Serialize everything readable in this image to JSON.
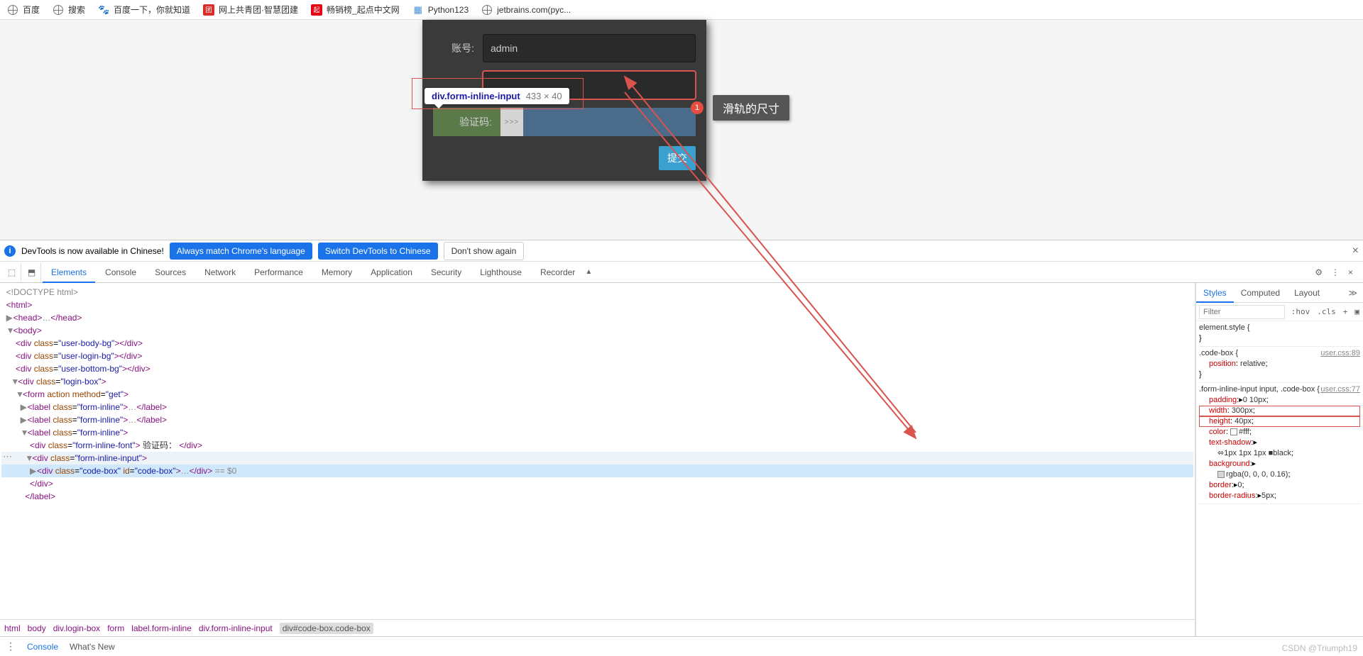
{
  "bookmarks": [
    {
      "icon": "globe",
      "label": "百度"
    },
    {
      "icon": "globe",
      "label": "搜索"
    },
    {
      "icon": "baidu",
      "label": "百度一下，你就知道"
    },
    {
      "icon": "red",
      "label": "网上共青团·智慧团建"
    },
    {
      "icon": "qidian",
      "label": "畅销榜_起点中文网"
    },
    {
      "icon": "python",
      "label": "Python123"
    },
    {
      "icon": "globe",
      "label": "jetbrains.com(pyc..."
    }
  ],
  "login": {
    "account_label": "账号:",
    "account_value": "admin",
    "captcha_label": "验证码:",
    "slider_hint": ">>>",
    "submit": "提交"
  },
  "inspect_tip": {
    "selector": "div.form-inline-input",
    "dims": "433 × 40"
  },
  "annotation": {
    "badge": "1",
    "text": "滑轨的尺寸"
  },
  "devtools": {
    "banner": {
      "msg": "DevTools is now available in Chinese!",
      "btn1": "Always match Chrome's language",
      "btn2": "Switch DevTools to Chinese",
      "btn3": "Don't show again"
    },
    "tabs": [
      "Elements",
      "Console",
      "Sources",
      "Network",
      "Performance",
      "Memory",
      "Application",
      "Security",
      "Lighthouse",
      "Recorder"
    ],
    "active_tab": "Elements",
    "dom": {
      "l0": "<!DOCTYPE html>",
      "code_text": "验证码：",
      "eq": "== $0"
    },
    "breadcrumbs": [
      "html",
      "body",
      "div.login-box",
      "form",
      "label.form-inline",
      "div.form-inline-input",
      "div#code-box.code-box"
    ],
    "styles": {
      "tabs": [
        "Styles",
        "Computed",
        "Layout"
      ],
      "filter_ph": "Filter",
      "hov": ":hov",
      "cls": ".cls",
      "r1": {
        "sel": "element.style {"
      },
      "r2": {
        "sel": ".code-box {",
        "src": "user.css:89",
        "p1n": "position",
        "p1v": "relative"
      },
      "r3": {
        "sel": ".form-inline-input input, .code-box {",
        "src": "user.css:77",
        "p1n": "padding",
        "p1v": "0 10px",
        "p2n": "width",
        "p2v": "300px",
        "p3n": "height",
        "p3v": "40px",
        "p4n": "color",
        "p4v": "#fff",
        "p5n": "text-shadow",
        "p5v": "1px 1px 1px ■black",
        "p6n": "background",
        "p6v": "rgba(0, 0, 0, 0.16)",
        "p7n": "border",
        "p7v": "0",
        "p8n": "border-radius",
        "p8v": "5px"
      }
    },
    "drawer": [
      "Console",
      "What's New"
    ]
  },
  "watermark": "CSDN @Triumph19"
}
